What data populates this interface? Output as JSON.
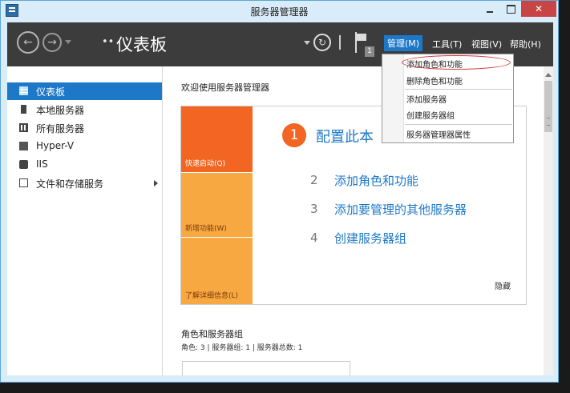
{
  "window": {
    "title": "服务器管理器"
  },
  "header": {
    "title": "仪表板",
    "breadcrumb_separator": "••",
    "notification_count": "1",
    "menus": {
      "manage": "管理(M)",
      "tools": "工具(T)",
      "view": "视图(V)",
      "help": "帮助(H)"
    }
  },
  "dropdown": {
    "items": [
      "添加角色和功能",
      "删除角色和功能",
      "添加服务器",
      "创建服务器组",
      "服务器管理器属性"
    ]
  },
  "sidebar": {
    "items": [
      {
        "label": "仪表板",
        "selected": true
      },
      {
        "label": "本地服务器"
      },
      {
        "label": "所有服务器"
      },
      {
        "label": "Hyper-V"
      },
      {
        "label": "IIS"
      },
      {
        "label": "文件和存储服务"
      }
    ]
  },
  "main": {
    "welcome": "欢迎使用服务器管理器",
    "tiles": [
      "快速启动(Q)",
      "新增功能(W)",
      "了解详细信息(L)"
    ],
    "step1": {
      "num": "1",
      "text": "配置此本"
    },
    "steps": [
      {
        "num": "2",
        "text": "添加角色和功能"
      },
      {
        "num": "3",
        "text": "添加要管理的其他服务器"
      },
      {
        "num": "4",
        "text": "创建服务器组"
      }
    ],
    "hide": "隐藏",
    "roles": {
      "title": "角色和服务器组",
      "summary": "角色: 3 | 服务器组: 1 | 服务器总数: 1"
    }
  },
  "colors": {
    "accent": "#1e78c8",
    "tile_primary": "#f26522",
    "tile_secondary": "#f7a841",
    "header_bg": "#3c3c3c"
  }
}
